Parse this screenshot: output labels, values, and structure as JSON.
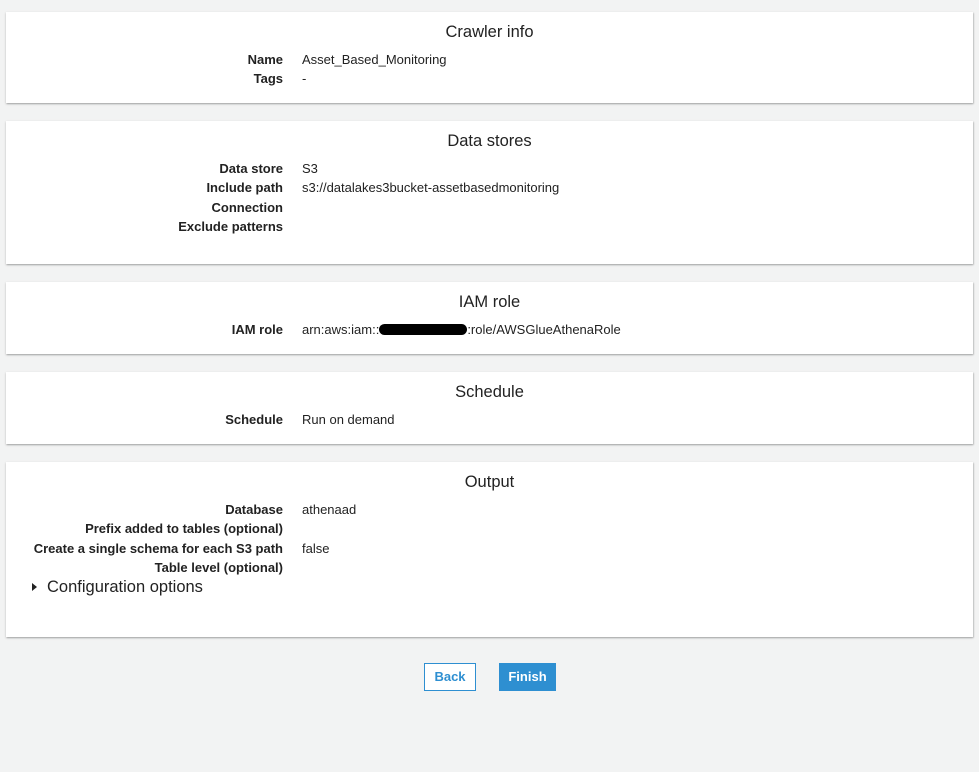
{
  "crawler_info": {
    "title": "Crawler info",
    "rows": [
      {
        "label": "Name",
        "value": "Asset_Based_Monitoring"
      },
      {
        "label": "Tags",
        "value": "-"
      }
    ]
  },
  "data_stores": {
    "title": "Data stores",
    "rows": [
      {
        "label": "Data store",
        "value": "S3"
      },
      {
        "label": "Include path",
        "value": "s3://datalakes3bucket-assetbasedmonitoring"
      },
      {
        "label": "Connection",
        "value": ""
      },
      {
        "label": "Exclude patterns",
        "value": ""
      }
    ]
  },
  "iam_role": {
    "title": "IAM role",
    "label": "IAM role",
    "value_prefix": "arn:aws:iam::",
    "value_suffix": ":role/AWSGlueAthenaRole"
  },
  "schedule": {
    "title": "Schedule",
    "rows": [
      {
        "label": "Schedule",
        "value": "Run on demand"
      }
    ]
  },
  "output": {
    "title": "Output",
    "rows": [
      {
        "label": "Database",
        "value": "athenaad"
      },
      {
        "label": "Prefix added to tables (optional)",
        "value": ""
      },
      {
        "label": "Create a single schema for each S3 path",
        "value": "false"
      },
      {
        "label": "Table level (optional)",
        "value": ""
      }
    ],
    "config_options_label": "Configuration options"
  },
  "buttons": {
    "back": "Back",
    "finish": "Finish"
  },
  "colors": {
    "accent": "#2e8fd1",
    "page_background": "#f2f3f3"
  }
}
